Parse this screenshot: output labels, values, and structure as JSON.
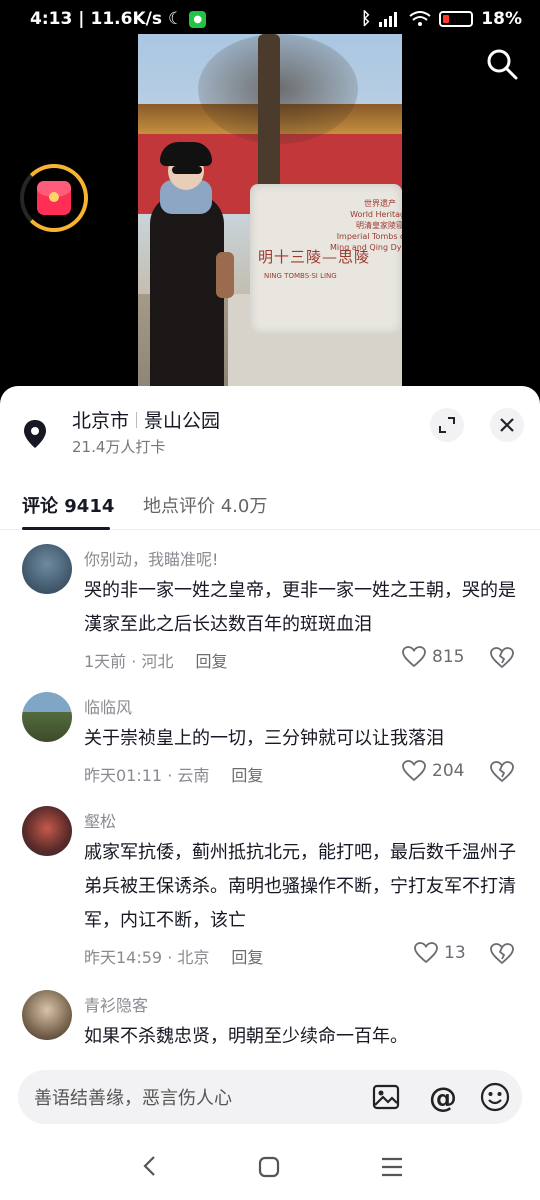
{
  "status_bar": {
    "time": "4:13",
    "speed": "11.6K/s",
    "battery": "18%",
    "battery_level_percent": 18
  },
  "video": {
    "stele_text": "明十三陵—思陵",
    "stele_subtitle": "NING TOMBS·SI LING",
    "stele_small_lines": [
      "世界遗产",
      "World Heritage",
      "明清皇家陵寝",
      "Imperial Tombs of the",
      "Ming and Qing Dynasties"
    ]
  },
  "location": {
    "city": "北京市",
    "place": "景山公园",
    "checkins": "21.4万人打卡"
  },
  "tabs": [
    {
      "label": "评论 9414"
    },
    {
      "label": "地点评价 4.0万"
    }
  ],
  "comments": [
    {
      "user": "你别动，我瞄准呢!",
      "text": "哭的非一家一姓之皇帝，更非一家一姓之王朝，哭的是漢家至此之后长达数百年的斑斑血泪",
      "time_location": "1天前 · 河北",
      "reply": "回复",
      "likes": "815"
    },
    {
      "user": "临临风",
      "text": "关于崇祯皇上的一切，三分钟就可以让我落泪",
      "time_location": "昨天01:11 · 云南",
      "reply": "回复",
      "likes": "204"
    },
    {
      "user": "壑松",
      "text": "戚家军抗倭，蓟州抵抗北元，能打吧，最后数千温州子弟兵被王保诱杀。南明也骚操作不断，宁打友军不打清军，内讧不断，该亡",
      "time_location": "昨天14:59 · 北京",
      "reply": "回复",
      "likes": "13"
    },
    {
      "user": "青衫隐客",
      "text": "如果不杀魏忠贤，明朝至少续命一百年。"
    }
  ],
  "input": {
    "placeholder": "善语结善缘，恶言伤人心",
    "at_symbol": "@"
  },
  "colors": {
    "accent_dark": "#161823",
    "muted": "#8a8b91",
    "redpack": "#ff2e55",
    "ring": "#f7b431"
  }
}
